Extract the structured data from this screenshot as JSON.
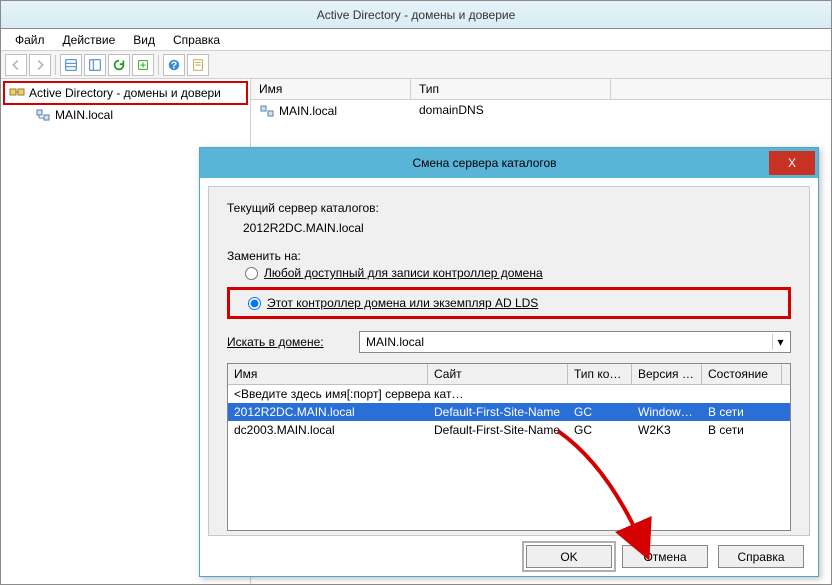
{
  "main": {
    "title": "Active Directory - домены и доверие",
    "menu": {
      "file": "Файл",
      "action": "Действие",
      "view": "Вид",
      "help": "Справка"
    },
    "tree": {
      "root": "Active Directory - домены и довери",
      "child": "MAIN.local"
    },
    "list": {
      "col_name": "Имя",
      "col_type": "Тип",
      "row_name": "MAIN.local",
      "row_type": "domainDNS"
    }
  },
  "dialog": {
    "title": "Смена сервера каталогов",
    "close": "X",
    "current_label": "Текущий сервер каталогов:",
    "current_server": "2012R2DC.MAIN.local",
    "replace_label": "Заменить на:",
    "radio_any": "Любой доступный для записи контроллер домена",
    "radio_this": "Этот контроллер домена или экземпляр AD LDS",
    "search_label": "Искать в домене:",
    "search_value": "MAIN.local",
    "grid": {
      "col_name": "Имя",
      "col_site": "Сайт",
      "col_type": "Тип конт…",
      "col_ver": "Версия …",
      "col_state": "Состояние",
      "hint": "<Введите здесь имя[:порт] сервера кат…",
      "rows": [
        {
          "name": "2012R2DC.MAIN.local",
          "site": "Default-First-Site-Name",
          "type": "GC",
          "ver": "Windows…",
          "state": "В сети"
        },
        {
          "name": "dc2003.MAIN.local",
          "site": "Default-First-Site-Name",
          "type": "GC",
          "ver": "W2K3",
          "state": "В сети"
        }
      ]
    },
    "buttons": {
      "ok": "OK",
      "cancel": "Отмена",
      "help": "Справка"
    }
  }
}
